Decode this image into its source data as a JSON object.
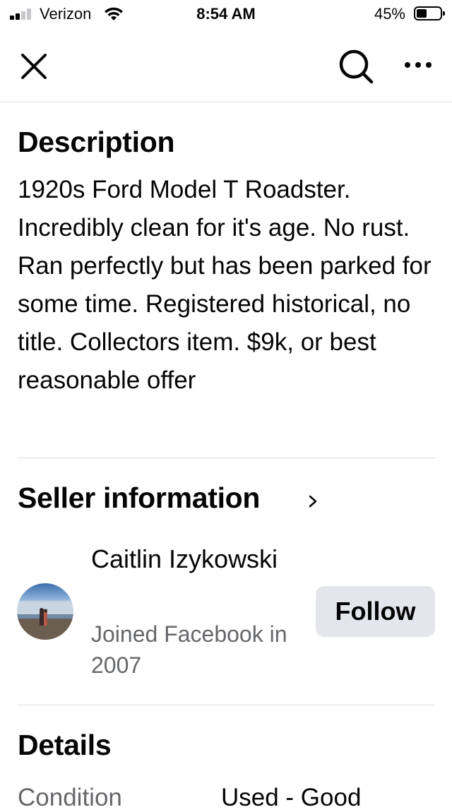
{
  "status_bar": {
    "carrier": "Verizon",
    "time": "8:54 AM",
    "battery_percent": "45%",
    "battery_level": 0.45,
    "signal_bars": 2
  },
  "nav": {
    "close_icon": "close-icon",
    "search_icon": "search-icon",
    "more_icon": "more-icon"
  },
  "description": {
    "title": "Description",
    "text": "1920s Ford Model T Roadster. Incredibly clean for it's age. No rust. Ran perfectly but has been parked for some time. Registered historical, no title. Collectors item. $9k, or best reasonable offer"
  },
  "seller": {
    "title": "Seller information",
    "name": "Caitlin Izykowski",
    "joined": "Joined Facebook in 2007",
    "follow_label": "Follow"
  },
  "details": {
    "title": "Details",
    "rows": [
      {
        "label": "Condition",
        "value": "Used - Good"
      }
    ]
  },
  "colors": {
    "text": "#050505",
    "secondary_text": "#65676b",
    "divider": "#dadde1",
    "button_bg": "#e4e6eb"
  }
}
